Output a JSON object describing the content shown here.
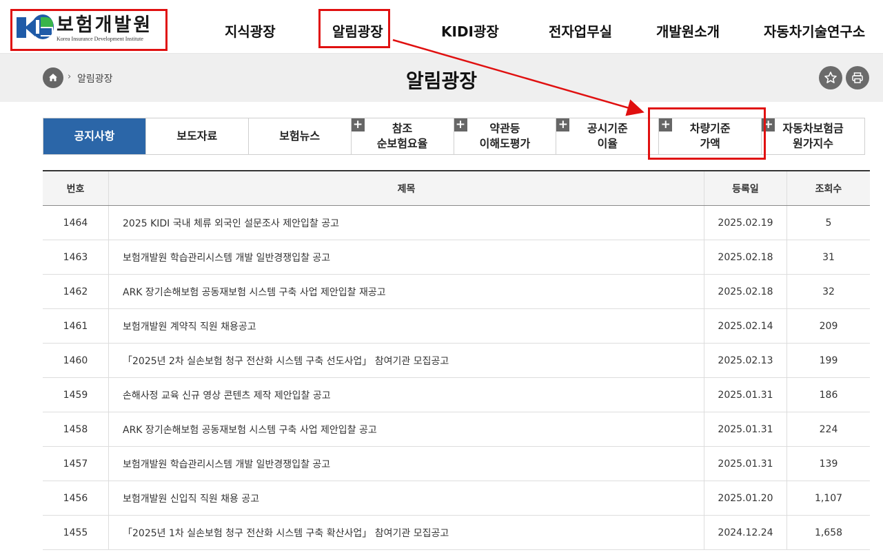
{
  "header": {
    "logo_ko": "보험개발원",
    "logo_en": "Korea Insurance Development Institute",
    "nav": [
      "지식광장",
      "알림광장",
      "KIDI광장",
      "전자업무실",
      "개발원소개",
      "자동차기술연구소"
    ]
  },
  "subheader": {
    "breadcrumb": "알림광장",
    "breadcrumb_sep": "›",
    "title": "알림광장"
  },
  "tabs": [
    {
      "line1": "공지사항",
      "line2": "",
      "plus": false,
      "active": true
    },
    {
      "line1": "보도자료",
      "line2": "",
      "plus": false,
      "active": false
    },
    {
      "line1": "보험뉴스",
      "line2": "",
      "plus": false,
      "active": false
    },
    {
      "line1": "참조",
      "line2": "순보험요율",
      "plus": true,
      "active": false
    },
    {
      "line1": "약관등",
      "line2": "이해도평가",
      "plus": true,
      "active": false
    },
    {
      "line1": "공시기준",
      "line2": "이율",
      "plus": true,
      "active": false
    },
    {
      "line1": "차량기준",
      "line2": "가액",
      "plus": true,
      "active": false
    },
    {
      "line1": "자동차보험금",
      "line2": "원가지수",
      "plus": true,
      "active": false
    }
  ],
  "table": {
    "headers": {
      "no": "번호",
      "title": "제목",
      "date": "등록일",
      "views": "조회수"
    },
    "rows": [
      {
        "no": "1464",
        "title": "2025 KIDI 국내 체류 외국인 설문조사 제안입찰 공고",
        "date": "2025.02.19",
        "views": "5"
      },
      {
        "no": "1463",
        "title": "보험개발원 학습관리시스템 개발 일반경쟁입찰 공고",
        "date": "2025.02.18",
        "views": "31"
      },
      {
        "no": "1462",
        "title": "ARK 장기손해보험 공동재보험 시스템 구축 사업 제안입찰 재공고",
        "date": "2025.02.18",
        "views": "32"
      },
      {
        "no": "1461",
        "title": "보험개발원 계약직 직원 채용공고",
        "date": "2025.02.14",
        "views": "209"
      },
      {
        "no": "1460",
        "title": "「2025년 2차 실손보험 청구 전산화 시스템 구축 선도사업」 참여기관 모집공고",
        "date": "2025.02.13",
        "views": "199"
      },
      {
        "no": "1459",
        "title": "손해사정 교육 신규 영상 콘텐츠 제작 제안입찰 공고",
        "date": "2025.01.31",
        "views": "186"
      },
      {
        "no": "1458",
        "title": "ARK 장기손해보험 공동재보험 시스템 구축 사업 제안입찰 공고",
        "date": "2025.01.31",
        "views": "224"
      },
      {
        "no": "1457",
        "title": "보험개발원 학습관리시스템 개발 일반경쟁입찰 공고",
        "date": "2025.01.31",
        "views": "139"
      },
      {
        "no": "1456",
        "title": "보험개발원 신입직 직원 채용 공고",
        "date": "2025.01.20",
        "views": "1,107"
      },
      {
        "no": "1455",
        "title": "「2025년 1차 실손보험 청구 전산화 시스템 구축 확산사업」 참여기관 모집공고",
        "date": "2024.12.24",
        "views": "1,658"
      }
    ]
  },
  "colors": {
    "accent": "#2b66a8",
    "annotation": "#e01010",
    "subbar": "#efefef"
  },
  "icons": [
    "home-icon",
    "star-icon",
    "print-icon",
    "plus-icon"
  ]
}
